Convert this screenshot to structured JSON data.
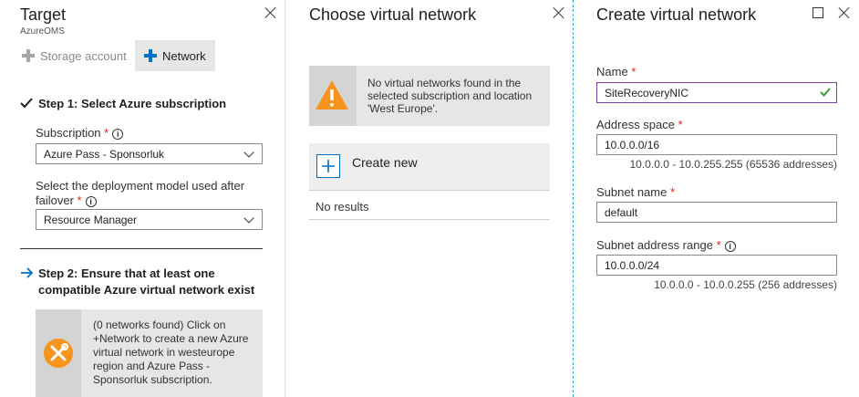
{
  "target_blade": {
    "title": "Target",
    "subtitle": "AzureOMS",
    "tabs": [
      {
        "label": "Storage account"
      },
      {
        "label": "Network"
      }
    ],
    "step1": {
      "heading": "Step 1: Select Azure subscription",
      "subscription_label": "Subscription",
      "subscription_value": "Azure Pass - Sponsorluk",
      "deployment_label_line1": "Select the deployment model used after",
      "deployment_label_line2": "failover",
      "deployment_value": "Resource Manager"
    },
    "step2": {
      "heading_line1": "Step 2: Ensure that at least one",
      "heading_line2": "compatible Azure virtual network exist",
      "notice_lines": [
        "(0 networks found) Click on",
        "+Network to create a new Azure",
        "virtual network in westeurope",
        "region and Azure Pass -",
        "Sponsorluk subscription."
      ]
    }
  },
  "choose_blade": {
    "title": "Choose virtual network",
    "warning_lines": [
      "No virtual networks found in the",
      "selected subscription and location",
      "'West Europe'."
    ],
    "create_new_label": "Create new",
    "no_results": "No results"
  },
  "create_blade": {
    "title": "Create virtual network",
    "name_label": "Name",
    "name_value": "SiteRecoveryNIC",
    "address_space_label": "Address space",
    "address_space_value": "10.0.0.0/16",
    "address_space_hint": "10.0.0.0 - 10.0.255.255 (65536 addresses)",
    "subnet_name_label": "Subnet name",
    "subnet_name_value": "default",
    "subnet_range_label": "Subnet address range",
    "subnet_range_value": "10.0.0.0/24",
    "subnet_range_hint": "10.0.0.0 - 10.0.0.255 (256 addresses)"
  },
  "colors": {
    "accent": "#0072c6",
    "warning": "#f7941d",
    "required": "#e01b1b",
    "valid": "#3c9b33",
    "panel_gray": "#e6e6e6",
    "dashed_border": "#35a7c8",
    "selected_field_border": "#7b3fa0"
  }
}
